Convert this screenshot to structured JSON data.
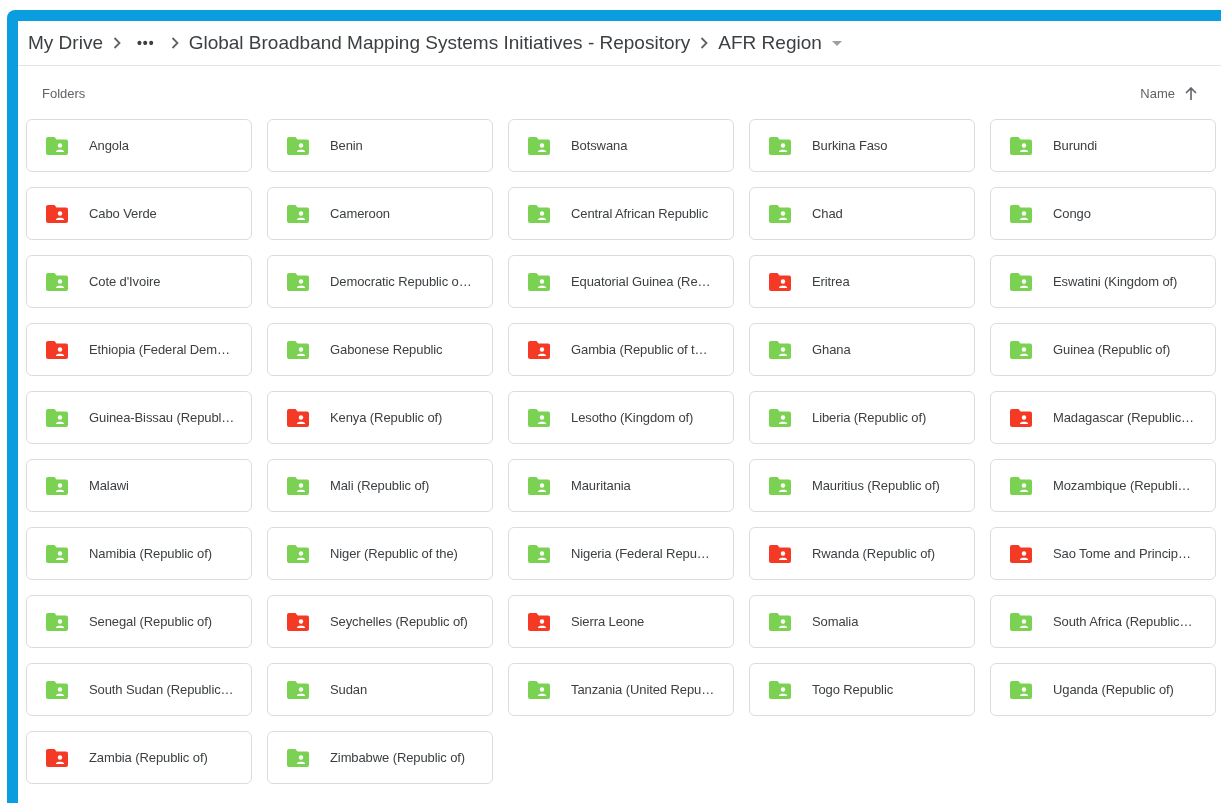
{
  "breadcrumb": {
    "root": "My Drive",
    "overflow": "•••",
    "parent": "Global Broadband Mapping Systems Initiatives - Repository",
    "current": "AFR Region"
  },
  "section_title": "Folders",
  "sort": {
    "label": "Name"
  },
  "folders": [
    {
      "name": "Angola",
      "color": "#7ad152"
    },
    {
      "name": "Benin",
      "color": "#7ad152"
    },
    {
      "name": "Botswana",
      "color": "#7ad152"
    },
    {
      "name": "Burkina Faso",
      "color": "#7ad152"
    },
    {
      "name": "Burundi",
      "color": "#7ad152"
    },
    {
      "name": "Cabo Verde",
      "color": "#f43a24"
    },
    {
      "name": "Cameroon",
      "color": "#7ad152"
    },
    {
      "name": "Central African Republic",
      "color": "#7ad152"
    },
    {
      "name": "Chad",
      "color": "#7ad152"
    },
    {
      "name": "Congo",
      "color": "#7ad152"
    },
    {
      "name": "Cote d'Ivoire",
      "color": "#7ad152"
    },
    {
      "name": "Democratic Republic o…",
      "color": "#7ad152"
    },
    {
      "name": "Equatorial Guinea (Re…",
      "color": "#7ad152"
    },
    {
      "name": "Eritrea",
      "color": "#f43a24"
    },
    {
      "name": "Eswatini (Kingdom of)",
      "color": "#7ad152"
    },
    {
      "name": "Ethiopia (Federal Dem…",
      "color": "#f43a24"
    },
    {
      "name": "Gabonese Republic",
      "color": "#7ad152"
    },
    {
      "name": "Gambia (Republic of t…",
      "color": "#f43a24"
    },
    {
      "name": "Ghana",
      "color": "#7ad152"
    },
    {
      "name": "Guinea (Republic of)",
      "color": "#7ad152"
    },
    {
      "name": "Guinea-Bissau (Republ…",
      "color": "#7ad152"
    },
    {
      "name": "Kenya (Republic of)",
      "color": "#f43a24"
    },
    {
      "name": "Lesotho (Kingdom of)",
      "color": "#7ad152"
    },
    {
      "name": "Liberia (Republic of)",
      "color": "#7ad152"
    },
    {
      "name": "Madagascar (Republic…",
      "color": "#f43a24"
    },
    {
      "name": "Malawi",
      "color": "#7ad152"
    },
    {
      "name": "Mali (Republic of)",
      "color": "#7ad152"
    },
    {
      "name": "Mauritania",
      "color": "#7ad152"
    },
    {
      "name": "Mauritius (Republic of)",
      "color": "#7ad152"
    },
    {
      "name": "Mozambique (Republi…",
      "color": "#7ad152"
    },
    {
      "name": "Namibia (Republic of)",
      "color": "#7ad152"
    },
    {
      "name": "Niger (Republic of the)",
      "color": "#7ad152"
    },
    {
      "name": "Nigeria (Federal Repu…",
      "color": "#7ad152"
    },
    {
      "name": "Rwanda (Republic of)",
      "color": "#f43a24"
    },
    {
      "name": "Sao Tome and Princip…",
      "color": "#f43a24"
    },
    {
      "name": "Senegal (Republic of)",
      "color": "#7ad152"
    },
    {
      "name": "Seychelles (Republic of)",
      "color": "#f43a24"
    },
    {
      "name": "Sierra Leone",
      "color": "#f43a24"
    },
    {
      "name": "Somalia",
      "color": "#7ad152"
    },
    {
      "name": "South Africa (Republic…",
      "color": "#7ad152"
    },
    {
      "name": "South Sudan (Republic…",
      "color": "#7ad152"
    },
    {
      "name": "Sudan",
      "color": "#7ad152"
    },
    {
      "name": "Tanzania (United Repu…",
      "color": "#7ad152"
    },
    {
      "name": "Togo Republic",
      "color": "#7ad152"
    },
    {
      "name": "Uganda (Republic of)",
      "color": "#7ad152"
    },
    {
      "name": "Zambia (Republic of)",
      "color": "#f43a24"
    },
    {
      "name": "Zimbabwe (Republic of)",
      "color": "#7ad152"
    }
  ]
}
